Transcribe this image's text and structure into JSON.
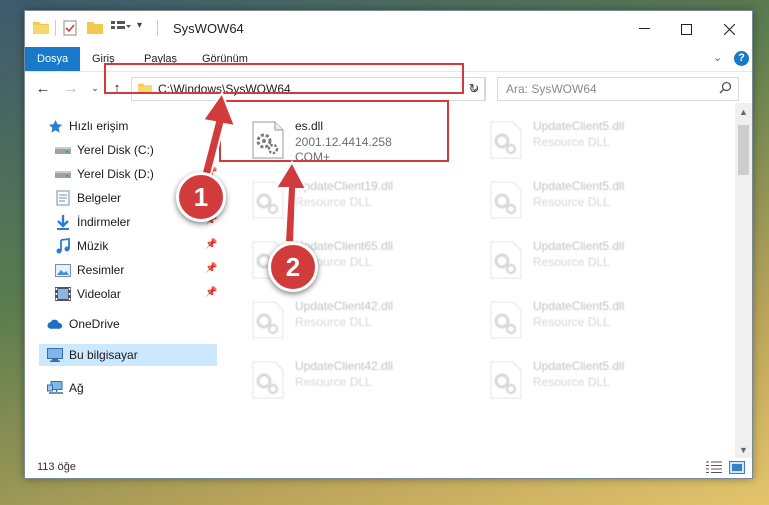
{
  "window": {
    "title": "SysWOW64",
    "minimize_icon": "minimize-icon",
    "maximize_icon": "maximize-icon",
    "close_icon": "close-icon"
  },
  "ribbon": {
    "tabs": [
      {
        "label": "Dosya",
        "active": true
      },
      {
        "label": "Giriş",
        "active": false
      },
      {
        "label": "Paylaş",
        "active": false
      },
      {
        "label": "Görünüm",
        "active": false
      }
    ]
  },
  "nav": {
    "address": "C:\\Windows\\SysWOW64",
    "search_placeholder": "Ara: SysWOW64"
  },
  "sidebar": {
    "items": [
      {
        "label": "Hızlı erişim",
        "icon": "star-icon",
        "pinned": false
      },
      {
        "label": "Yerel Disk (C:)",
        "icon": "drive-icon",
        "pinned": true
      },
      {
        "label": "Yerel Disk (D:)",
        "icon": "drive-icon",
        "pinned": true
      },
      {
        "label": "Belgeler",
        "icon": "documents-icon",
        "pinned": true
      },
      {
        "label": "İndirmeler",
        "icon": "download-icon",
        "pinned": true
      },
      {
        "label": "Müzik",
        "icon": "music-icon",
        "pinned": true
      },
      {
        "label": "Resimler",
        "icon": "pictures-icon",
        "pinned": true
      },
      {
        "label": "Videolar",
        "icon": "video-icon",
        "pinned": true
      },
      {
        "label": "OneDrive",
        "icon": "cloud-icon",
        "pinned": false
      },
      {
        "label": "Bu bilgisayar",
        "icon": "computer-icon",
        "pinned": false,
        "selected": true
      },
      {
        "label": "Ağ",
        "icon": "network-icon",
        "pinned": false
      }
    ]
  },
  "files": [
    {
      "name": "es.dll",
      "line1": "2001.12.4414.258",
      "line2": "COM+",
      "highlighted": true
    },
    {
      "name": "UpdateClient5.dll",
      "line1": "Resource DLL",
      "line2": ""
    },
    {
      "name": "UpdateClient19.dll",
      "line1": "Resource DLL",
      "line2": ""
    },
    {
      "name": "UpdateClient5.dll",
      "line1": "Resource DLL",
      "line2": ""
    },
    {
      "name": "UpdateClient65.dll",
      "line1": "Resource DLL",
      "line2": ""
    },
    {
      "name": "UpdateClient5.dll",
      "line1": "Resource DLL",
      "line2": ""
    },
    {
      "name": "UpdateClient42.dll",
      "line1": "Resource DLL",
      "line2": ""
    },
    {
      "name": "UpdateClient5.dll",
      "line1": "Resource DLL",
      "line2": ""
    },
    {
      "name": "UpdateClient42.dll",
      "line1": "Resource DLL",
      "line2": ""
    },
    {
      "name": "UpdateClient5.dll",
      "line1": "Resource DLL",
      "line2": ""
    }
  ],
  "status": {
    "count": "113 öğe"
  },
  "annotations": {
    "step1": "1",
    "step2": "2",
    "color": "#d23b3b"
  }
}
